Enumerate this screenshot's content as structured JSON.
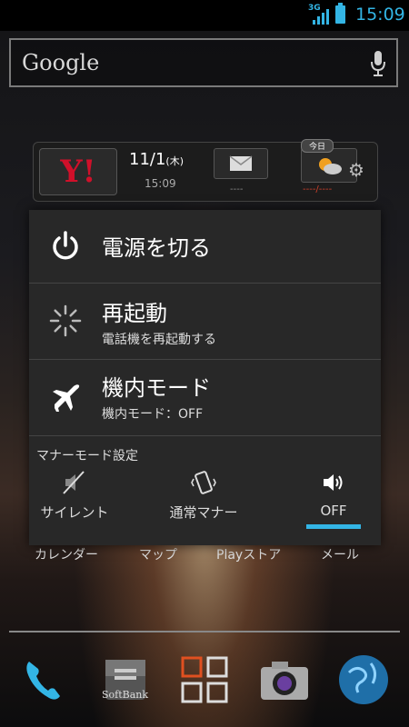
{
  "status_bar": {
    "network": "3G",
    "time": "15:09",
    "accent": "#33b5e5"
  },
  "search": {
    "logo": "Google",
    "mic_icon": "mic-icon"
  },
  "yahoo_widget": {
    "logo": "Y!",
    "date": "11/1",
    "weekday": "(木)",
    "time": "15:09",
    "mail_count": "----",
    "today_badge": "今日",
    "weather_temp": "----/----"
  },
  "power_dialog": {
    "items": [
      {
        "title": "電源を切る",
        "icon": "power-icon"
      },
      {
        "title": "再起動",
        "subtitle": "電話機を再起動する",
        "icon": "spinner-icon"
      },
      {
        "title": "機内モード",
        "subtitle": "機内モード：OFF",
        "icon": "airplane-icon"
      }
    ],
    "manner_section_label": "マナーモード設定",
    "manner_options": [
      {
        "label": "サイレント",
        "icon": "silent-icon",
        "selected": false
      },
      {
        "label": "通常マナー",
        "icon": "vibrate-icon",
        "selected": false
      },
      {
        "label": "OFF",
        "icon": "speaker-icon",
        "selected": true
      }
    ]
  },
  "app_labels": [
    "カレンダー",
    "マップ",
    "Playストア",
    "メール"
  ],
  "dock": {
    "items": [
      {
        "name": "phone-icon"
      },
      {
        "name": "softbank-mail-icon",
        "label": "SoftBank"
      },
      {
        "name": "apps-grid-icon"
      },
      {
        "name": "camera-icon"
      },
      {
        "name": "browser-globe-icon"
      }
    ]
  }
}
